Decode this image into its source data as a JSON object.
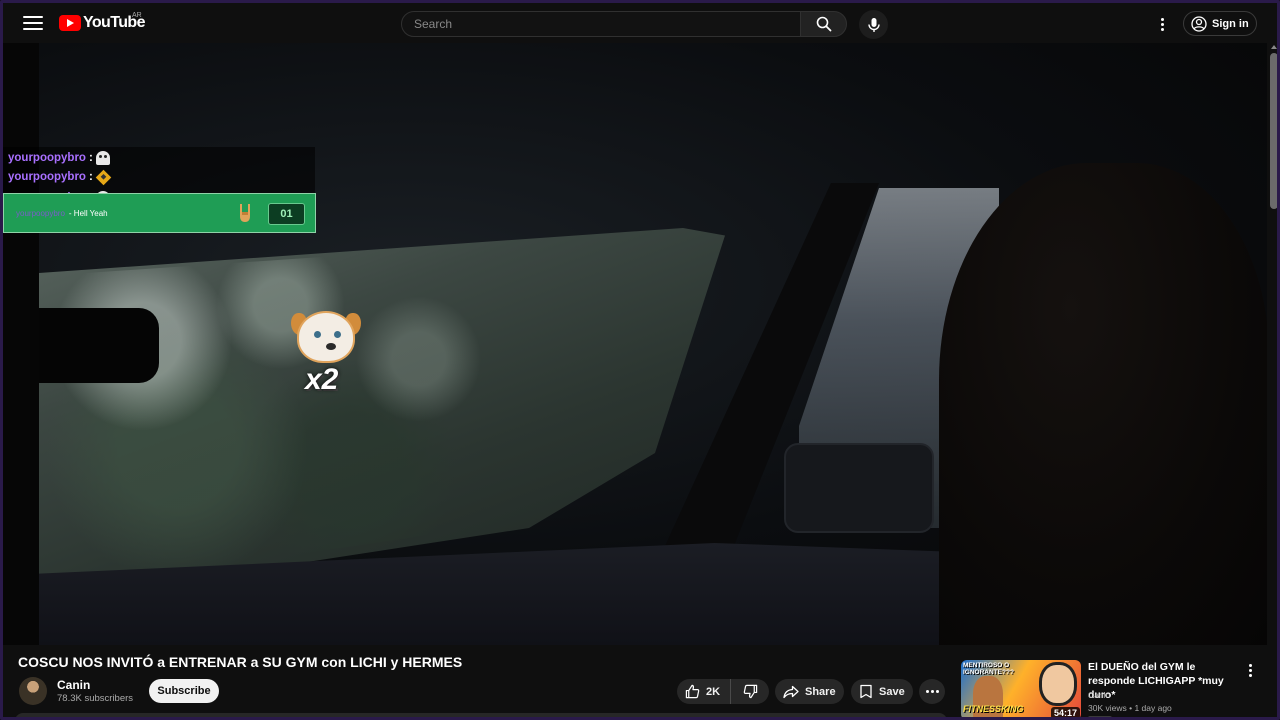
{
  "header": {
    "logo_text": "YouTube",
    "country_code": "AR",
    "search_placeholder": "Search",
    "signin_label": "Sign in"
  },
  "chat": {
    "messages": [
      {
        "user": "yourpoopybro",
        "separator": ":",
        "emote": "ghost-emote"
      },
      {
        "user": "yourpoopybro",
        "separator": ":",
        "emote": "diamond-emote"
      },
      {
        "user": "yourpoopybro",
        "separator": ":",
        "emote": "ghost-emote"
      },
      {
        "user": "yourpoopybro",
        "separator": ":",
        "emote": "diamond-emote"
      }
    ],
    "redeem": {
      "user": "yourpoopybro",
      "text": "- Hell Yeah",
      "icon": "rock-hand-icon",
      "count": "01"
    },
    "overlay_emote": {
      "icon": "dog-emote",
      "multiplier": "x2"
    }
  },
  "video": {
    "title": "COSCU NOS INVITÓ a ENTRENAR a SU GYM con LICHI y HERMES",
    "channel": "Canin",
    "subscribers": "78.3K subscribers",
    "subscribe_label": "Subscribe",
    "likes": "2K",
    "share_label": "Share",
    "save_label": "Save"
  },
  "recommendation": {
    "title": "El DUEÑO del GYM le responde LICHIGAPP *muy duro*",
    "channel": "Canin",
    "meta": "30K views • 1 day ago",
    "duration": "54:17",
    "thumb_text_top": "MENTIROSO O IGNORANTE???",
    "thumb_text_bottom": "FITNESSKING"
  },
  "colors": {
    "background": "#0f0f0f",
    "brand_red": "#ff0000",
    "chat_username": "#a970ff",
    "redeem_green": "#1f9d55"
  }
}
